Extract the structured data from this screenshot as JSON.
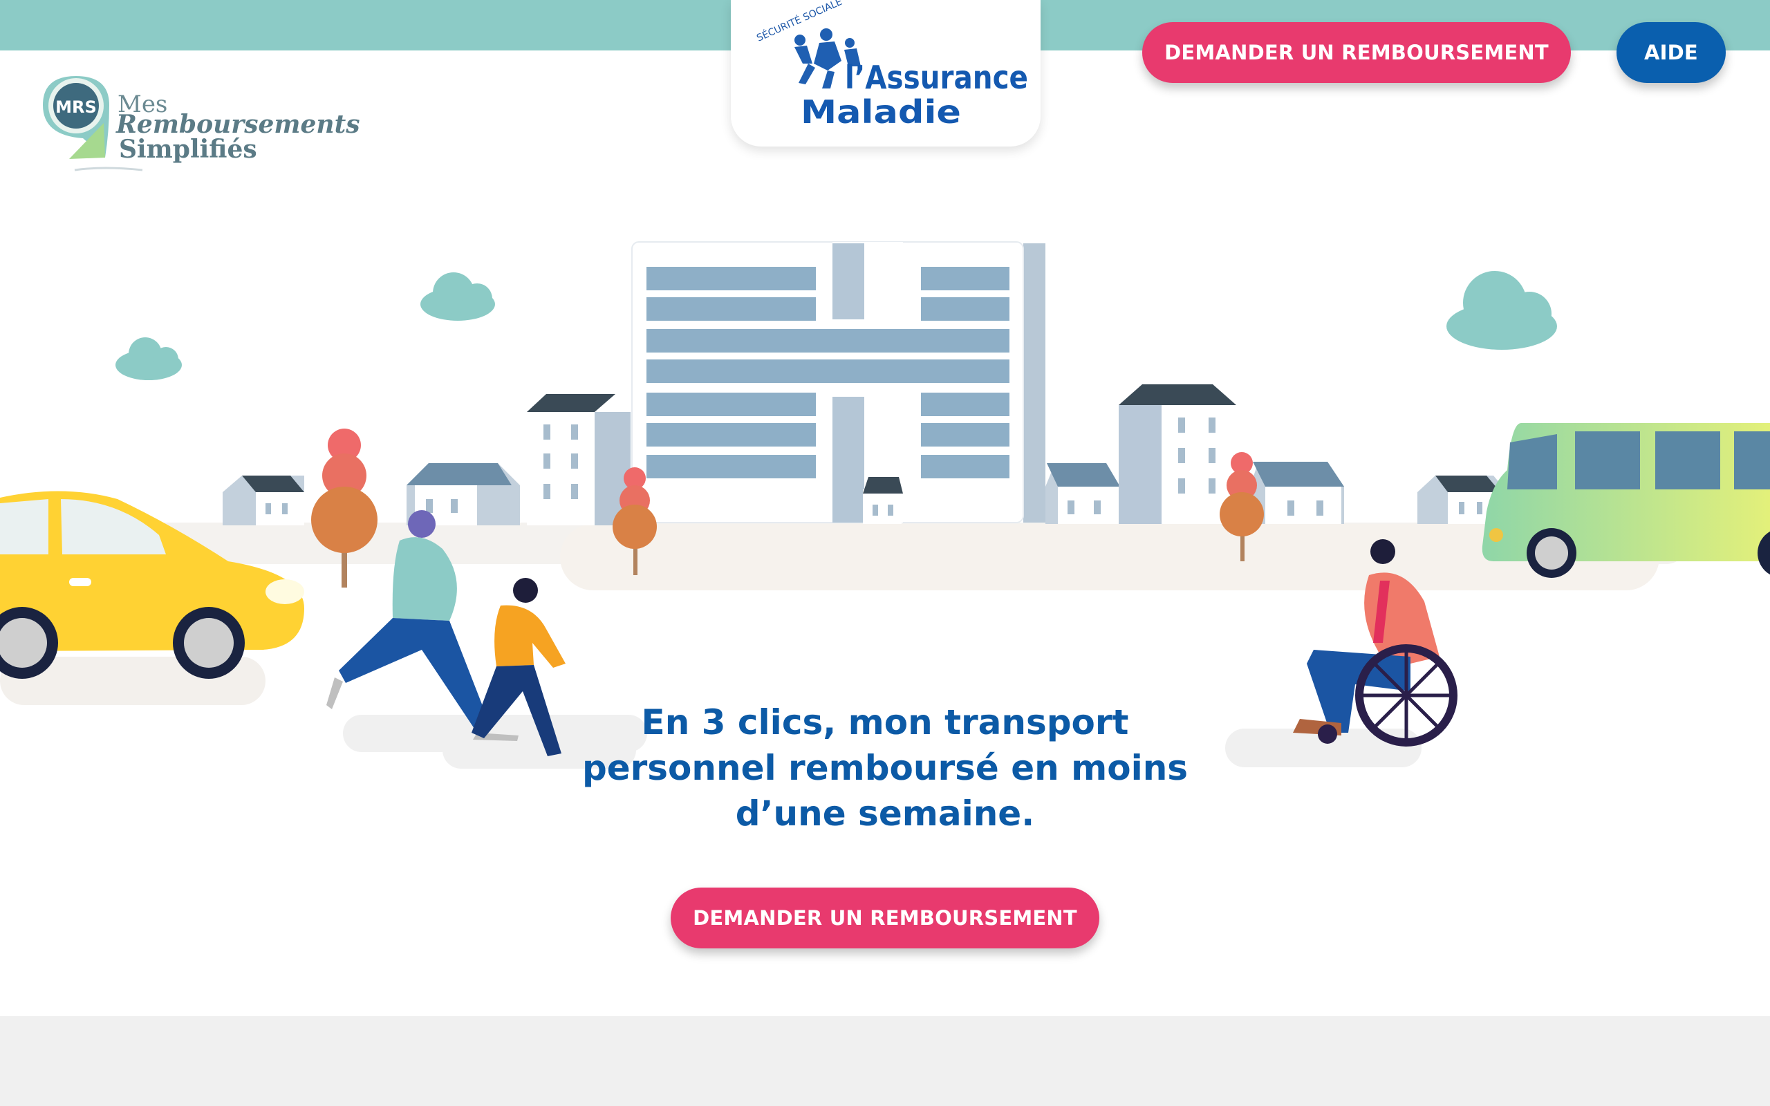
{
  "header": {
    "mrs_logo": {
      "badge": "MRS",
      "line1": "Mes",
      "line2": "Remboursements",
      "line3": "Simplifiés"
    },
    "assurance_logo": {
      "arc_text": "SÉCURITÉ SOCIALE",
      "line1": "l’Assurance",
      "line2": "Maladie"
    },
    "request_button_label": "DEMANDER UN REMBOURSEMENT",
    "help_button_label": "AIDE"
  },
  "hero": {
    "title_line1": "En 3 clics, mon transport",
    "title_line2": "personnel remboursé en moins",
    "title_line3": "d’une semaine.",
    "cta_label": "DEMANDER UN REMBOURSEMENT"
  },
  "colors": {
    "accent_pink": "#e83a6e",
    "brand_blue": "#0a5fae",
    "top_bar": "#8ccbc6",
    "title_blue": "#0c5aa6"
  }
}
